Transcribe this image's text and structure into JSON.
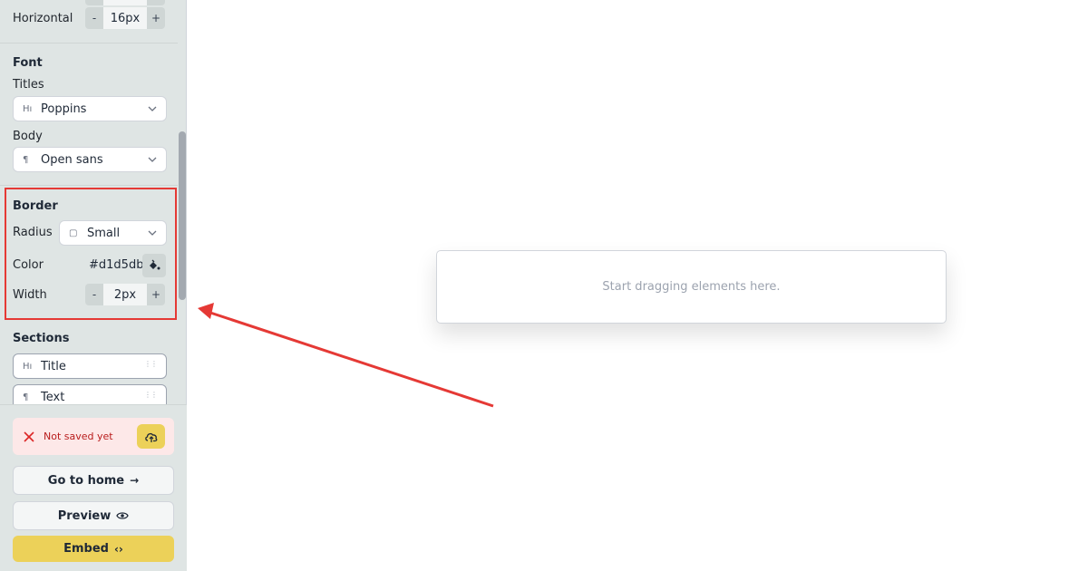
{
  "sidebar": {
    "spacing": {
      "horizontal_label": "Horizontal",
      "horizontal_value": "16px",
      "minus": "-",
      "plus": "+"
    },
    "font": {
      "title": "Font",
      "titles_label": "Titles",
      "titles_value": "Poppins",
      "titles_icon": "Hı",
      "body_label": "Body",
      "body_value": "Open sans",
      "body_icon": "¶"
    },
    "border": {
      "title": "Border",
      "radius_label": "Radius",
      "radius_value": "Small",
      "radius_icon": "▢",
      "color_label": "Color",
      "color_value": "#d1d5db",
      "width_label": "Width",
      "width_value": "2px",
      "minus": "-",
      "plus": "+"
    },
    "sections": {
      "title": "Sections",
      "items": [
        {
          "label": "Title",
          "icon": "Hı"
        },
        {
          "label": "Text",
          "icon": "¶"
        }
      ]
    }
  },
  "bottom": {
    "status_text": "Not saved yet",
    "go_home_label": "Go to home",
    "go_home_icon": "→",
    "preview_label": "Preview",
    "embed_label": "Embed",
    "embed_icon": "‹›"
  },
  "canvas": {
    "placeholder": "Start dragging elements here."
  },
  "colors": {
    "accent": "#ecd159",
    "annotation": "#e53935",
    "sidebar_bg": "#dfe5e4",
    "error_bg": "#fde8e8"
  }
}
